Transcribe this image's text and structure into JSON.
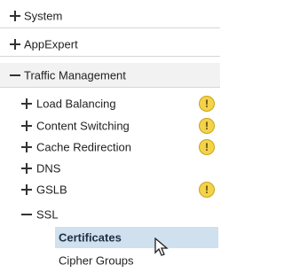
{
  "menu": {
    "system": {
      "label": "System"
    },
    "appexpert": {
      "label": "AppExpert"
    },
    "traffic_management": {
      "label": "Traffic Management",
      "children": [
        {
          "label": "Load Balancing",
          "warning": "!"
        },
        {
          "label": "Content Switching",
          "warning": "!"
        },
        {
          "label": "Cache Redirection",
          "warning": "!"
        },
        {
          "label": "DNS"
        },
        {
          "label": "GSLB",
          "warning": "!"
        },
        {
          "label": "SSL"
        }
      ],
      "ssl_children": [
        {
          "label": "Certificates"
        },
        {
          "label": "Cipher Groups"
        }
      ]
    }
  },
  "icons": {
    "expand": "plus",
    "collapse": "minus",
    "warning": "warning-icon",
    "cursor": "mouse-pointer-icon"
  },
  "colors": {
    "selected_bg": "#cfe0ef",
    "warning": "#f3d34a"
  }
}
